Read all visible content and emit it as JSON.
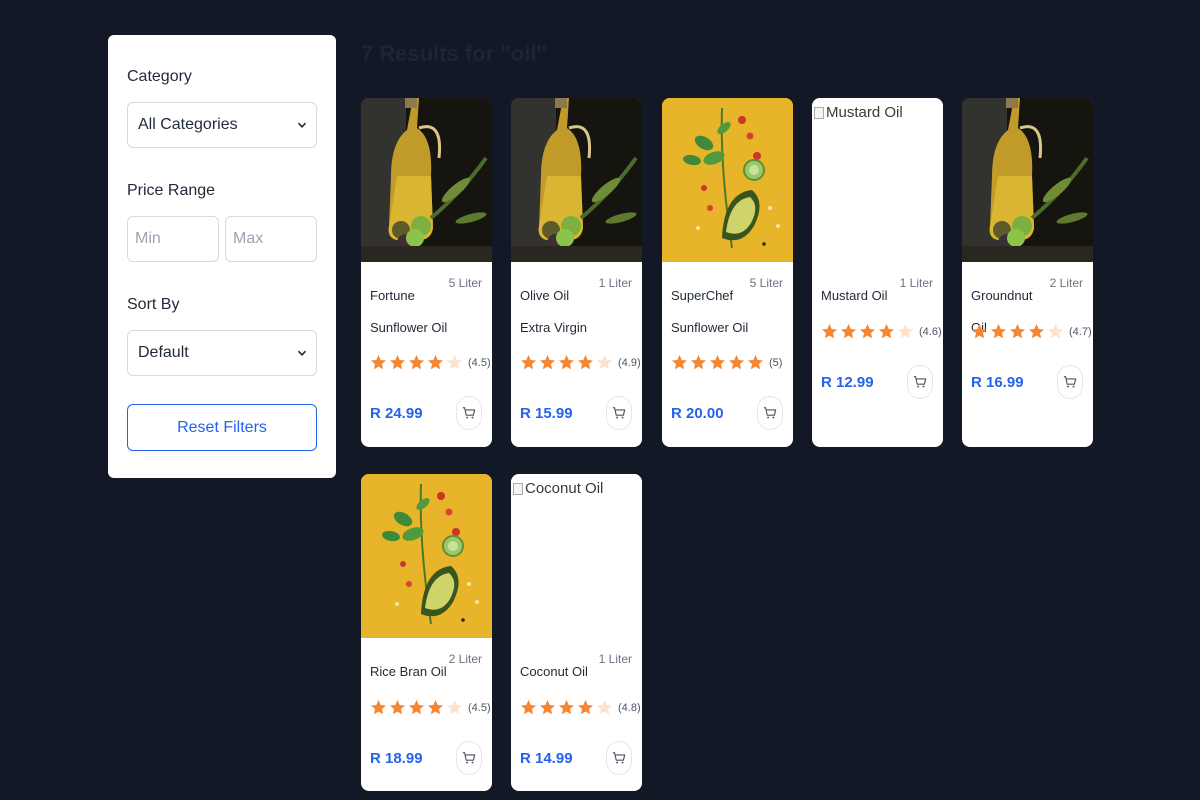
{
  "results_title": "7 Results for \"oil\"",
  "filters": {
    "category_label": "Category",
    "category_value": "All Categories",
    "price_label": "Price Range",
    "min_placeholder": "Min",
    "max_placeholder": "Max",
    "sort_label": "Sort By",
    "sort_value": "Default",
    "reset_label": "Reset Filters"
  },
  "colors": {
    "accent": "#2563eb",
    "star": "#f58733",
    "star_empty": "#fde3cc",
    "background": "#121826"
  },
  "products": [
    {
      "name": "Fortune Sunflower Oil",
      "size": "5 Liter",
      "rating": 4.5,
      "rating_text": "(4.5)",
      "price": "R 24.99",
      "image": "oil-bottle",
      "alt": ""
    },
    {
      "name": "Olive Oil Extra Virgin",
      "size": "1 Liter",
      "rating": 4.9,
      "rating_text": "(4.9)",
      "price": "R 15.99",
      "image": "oil-bottle",
      "alt": ""
    },
    {
      "name": "SuperChef Sunflower Oil",
      "size": "5 Liter",
      "rating": 5,
      "rating_text": "(5)",
      "price": "R 20.00",
      "image": "vegetables",
      "alt": ""
    },
    {
      "name": "Mustard Oil",
      "size": "1 Liter",
      "rating": 4.6,
      "rating_text": "(4.6)",
      "price": "R 12.99",
      "image": "missing",
      "alt": "Mustard Oil"
    },
    {
      "name": "Groundnut Oil",
      "size": "2 Liter",
      "rating": 4.7,
      "rating_text": "(4.7)",
      "price": "R 16.99",
      "image": "oil-bottle",
      "alt": ""
    },
    {
      "name": "Rice Bran Oil",
      "size": "2 Liter",
      "rating": 4.5,
      "rating_text": "(4.5)",
      "price": "R 18.99",
      "image": "vegetables",
      "alt": ""
    },
    {
      "name": "Coconut Oil",
      "size": "1 Liter",
      "rating": 4.8,
      "rating_text": "(4.8)",
      "price": "R 14.99",
      "image": "missing",
      "alt": "Coconut Oil"
    }
  ]
}
